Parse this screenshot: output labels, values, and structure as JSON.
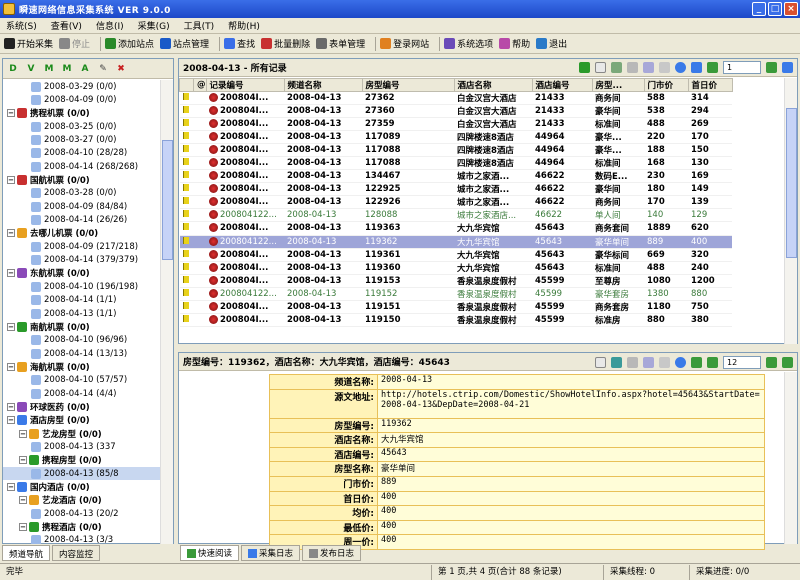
{
  "window": {
    "title": "瞬速网络信息采集系统 VER 9.0.0",
    "min": "_",
    "max": "□",
    "close": "×"
  },
  "menu": [
    "系统(S)",
    "查看(V)",
    "信息(I)",
    "采集(G)",
    "工具(T)",
    "帮助(H)"
  ],
  "toolbar": [
    {
      "label": "开始采集",
      "icon": "play-icon",
      "color": "#222",
      "disabled": false
    },
    {
      "label": "停止",
      "icon": "stop-icon",
      "color": "#888",
      "disabled": true
    },
    {
      "label": "添加站点",
      "icon": "add-site-icon",
      "color": "#2a8a2a",
      "disabled": false
    },
    {
      "label": "站点管理",
      "icon": "site-manage-icon",
      "color": "#1a5ac8",
      "disabled": false
    },
    {
      "label": "查找",
      "icon": "find-icon",
      "color": "#3a6ee8",
      "disabled": false
    },
    {
      "label": "批量删除",
      "icon": "batch-delete-icon",
      "color": "#c83030",
      "disabled": false
    },
    {
      "label": "表单管理",
      "icon": "form-manage-icon",
      "color": "#6a6a6a",
      "disabled": false
    },
    {
      "label": "登录网站",
      "icon": "login-icon",
      "color": "#e08020",
      "disabled": false
    },
    {
      "label": "系统选项",
      "icon": "options-icon",
      "color": "#6a4ab8",
      "disabled": false
    },
    {
      "label": "帮助",
      "icon": "help-icon",
      "color": "#b84aa8",
      "disabled": false
    },
    {
      "label": "退出",
      "icon": "exit-icon",
      "color": "#2a7ac8",
      "disabled": false
    }
  ],
  "left_toolbar": [
    "D",
    "V",
    "M",
    "M",
    "A",
    "✎",
    "✖"
  ],
  "tree": [
    {
      "text": "2008-03-29 (0/0)",
      "level": 3,
      "bold": false
    },
    {
      "text": "2008-04-09 (0/0)",
      "level": 3,
      "bold": false
    },
    {
      "text": "携程机票 (0/0)",
      "level": 1,
      "bold": true
    },
    {
      "text": "2008-03-25 (0/0)",
      "level": 3,
      "bold": false
    },
    {
      "text": "2008-03-27 (0/0)",
      "level": 3,
      "bold": false
    },
    {
      "text": "2008-04-10 (28/28)",
      "level": 3,
      "bold": false
    },
    {
      "text": "2008-04-14 (268/268)",
      "level": 3,
      "bold": false
    },
    {
      "text": "国航机票 (0/0)",
      "level": 1,
      "bold": true
    },
    {
      "text": "2008-03-28 (0/0)",
      "level": 3,
      "bold": false
    },
    {
      "text": "2008-04-09 (84/84)",
      "level": 3,
      "bold": false
    },
    {
      "text": "2008-04-14 (26/26)",
      "level": 3,
      "bold": false
    },
    {
      "text": "去哪儿机票 (0/0)",
      "level": 1,
      "bold": true
    },
    {
      "text": "2008-04-09 (217/218)",
      "level": 3,
      "bold": false
    },
    {
      "text": "2008-04-14 (379/379)",
      "level": 3,
      "bold": false
    },
    {
      "text": "东航机票 (0/0)",
      "level": 1,
      "bold": true
    },
    {
      "text": "2008-04-10 (196/198)",
      "level": 3,
      "bold": false
    },
    {
      "text": "2008-04-14 (1/1)",
      "level": 3,
      "bold": false
    },
    {
      "text": "2008-04-13 (1/1)",
      "level": 3,
      "bold": false
    },
    {
      "text": "南航机票 (0/0)",
      "level": 1,
      "bold": true
    },
    {
      "text": "2008-04-10 (96/96)",
      "level": 3,
      "bold": false
    },
    {
      "text": "2008-04-14 (13/13)",
      "level": 3,
      "bold": false
    },
    {
      "text": "海航机票 (0/0)",
      "level": 1,
      "bold": true
    },
    {
      "text": "2008-04-10 (57/57)",
      "level": 3,
      "bold": false
    },
    {
      "text": "2008-04-14 (4/4)",
      "level": 3,
      "bold": false
    },
    {
      "text": "环球医药 (0/0)",
      "level": 1,
      "bold": true
    },
    {
      "text": "酒店房型 (0/0)",
      "level": 1,
      "bold": true
    },
    {
      "text": "艺龙房型 (0/0)",
      "level": 2,
      "bold": true
    },
    {
      "text": "2008-04-13 (337",
      "level": 3,
      "bold": false
    },
    {
      "text": "携程房型 (0/0)",
      "level": 2,
      "bold": true
    },
    {
      "text": "2008-04-13 (85/8",
      "level": 3,
      "bold": false,
      "sel": true
    },
    {
      "text": "国内酒店 (0/0)",
      "level": 1,
      "bold": true
    },
    {
      "text": "艺龙酒店 (0/0)",
      "level": 2,
      "bold": true
    },
    {
      "text": "2008-04-13 (20/2",
      "level": 3,
      "bold": false
    },
    {
      "text": "携程酒店 (0/0)",
      "level": 2,
      "bold": true
    },
    {
      "text": "2008-04-13 (3/3",
      "level": 3,
      "bold": false
    },
    {
      "text": "天天船舶 (0/0)",
      "level": 1,
      "bold": true
    }
  ],
  "left_tabs": [
    "频道导航",
    "内容监控"
  ],
  "grid": {
    "title": "2008-04-13 - 所有记录",
    "page_input": "1",
    "columns": [
      "",
      "记录编号",
      "频道名称",
      "房型编号",
      "酒店名称",
      "酒店编号",
      "房型...",
      "门市价",
      "首日价"
    ],
    "rows": [
      {
        "cells": [
          "200804I...",
          "2008-04-13",
          "27362",
          "白金汉宫大酒店",
          "21433",
          "商务间",
          "588",
          "314"
        ],
        "style": "bold"
      },
      {
        "cells": [
          "200804I...",
          "2008-04-13",
          "27360",
          "白金汉宫大酒店",
          "21433",
          "豪华间",
          "538",
          "294"
        ],
        "style": "bold"
      },
      {
        "cells": [
          "200804I...",
          "2008-04-13",
          "27359",
          "白金汉宫大酒店",
          "21433",
          "标准间",
          "488",
          "269"
        ],
        "style": "bold"
      },
      {
        "cells": [
          "200804I...",
          "2008-04-13",
          "117089",
          "四牌楼速8酒店",
          "44964",
          "豪华...",
          "220",
          "170"
        ],
        "style": "bold"
      },
      {
        "cells": [
          "200804I...",
          "2008-04-13",
          "117088",
          "四牌楼速8酒店",
          "44964",
          "豪华...",
          "188",
          "150"
        ],
        "style": "bold"
      },
      {
        "cells": [
          "200804I...",
          "2008-04-13",
          "117088",
          "四牌楼速8酒店",
          "44964",
          "标准间",
          "168",
          "130"
        ],
        "style": "bold"
      },
      {
        "cells": [
          "200804I...",
          "2008-04-13",
          "134467",
          "城市之家酒...",
          "46622",
          "数码E...",
          "230",
          "169"
        ],
        "style": "bold"
      },
      {
        "cells": [
          "200804I...",
          "2008-04-13",
          "122925",
          "城市之家酒...",
          "46622",
          "豪华间",
          "180",
          "149"
        ],
        "style": "bold"
      },
      {
        "cells": [
          "200804I...",
          "2008-04-13",
          "122926",
          "城市之家酒...",
          "46622",
          "商务间",
          "170",
          "139"
        ],
        "style": "bold"
      },
      {
        "cells": [
          "200804122...",
          "2008-04-13",
          "128088",
          "城市之家酒店...",
          "46622",
          "单人间",
          "140",
          "129"
        ],
        "style": "gray"
      },
      {
        "cells": [
          "200804I...",
          "2008-04-13",
          "119363",
          "大九华宾馆",
          "45643",
          "商务套间",
          "1889",
          "620"
        ],
        "style": "bold"
      },
      {
        "cells": [
          "200804122...",
          "2008-04-13",
          "119362",
          "大九华宾馆",
          "45643",
          "豪华单间",
          "889",
          "400"
        ],
        "style": "sel"
      },
      {
        "cells": [
          "200804I...",
          "2008-04-13",
          "119361",
          "大九华宾馆",
          "45643",
          "豪华标间",
          "669",
          "320"
        ],
        "style": "bold"
      },
      {
        "cells": [
          "200804I...",
          "2008-04-13",
          "119360",
          "大九华宾馆",
          "45643",
          "标准间",
          "488",
          "240"
        ],
        "style": "bold"
      },
      {
        "cells": [
          "200804I...",
          "2008-04-13",
          "119153",
          "香泉温泉度假村",
          "45599",
          "至尊房",
          "1080",
          "1200"
        ],
        "style": "bold"
      },
      {
        "cells": [
          "200804122...",
          "2008-04-13",
          "119152",
          "香泉温泉度假村",
          "45599",
          "豪华套房",
          "1380",
          "880"
        ],
        "style": "gray"
      },
      {
        "cells": [
          "200804I...",
          "2008-04-13",
          "119151",
          "香泉温泉度假村",
          "45599",
          "商务套房",
          "1180",
          "750"
        ],
        "style": "bold"
      },
      {
        "cells": [
          "200804I...",
          "2008-04-13",
          "119150",
          "香泉温泉度假村",
          "45599",
          "标准房",
          "880",
          "380"
        ],
        "style": "bold"
      }
    ]
  },
  "detail": {
    "title": "房型编号：119362，酒店名称：大九华宾馆，酒店编号：45643",
    "page_input": "12",
    "fields": [
      {
        "k": "频道名称:",
        "v": "2008-04-13"
      },
      {
        "k": "源文地址:",
        "v": "http://hotels.ctrip.com/Domestic/ShowHotelInfo.aspx?hotel=45643&StartDate=2008-04-13&DepDate=2008-04-21"
      },
      {
        "k": "房型编号:",
        "v": "119362"
      },
      {
        "k": "酒店名称:",
        "v": "大九华宾馆"
      },
      {
        "k": "酒店编号:",
        "v": "45643"
      },
      {
        "k": "房型名称:",
        "v": "豪华单间"
      },
      {
        "k": "门市价:",
        "v": "889"
      },
      {
        "k": "首日价:",
        "v": "400"
      },
      {
        "k": "均价:",
        "v": "400"
      },
      {
        "k": "最低价:",
        "v": "400"
      },
      {
        "k": "周一价:",
        "v": "400"
      }
    ]
  },
  "bottom_tabs": [
    "快速阅读",
    "采集日志",
    "发布日志"
  ],
  "status": {
    "left": "完毕",
    "page": "第 1 页,共 4 页(合计 88 条记录)",
    "thread": "采集线程: 0",
    "progress": "采集进度: 0/0"
  }
}
